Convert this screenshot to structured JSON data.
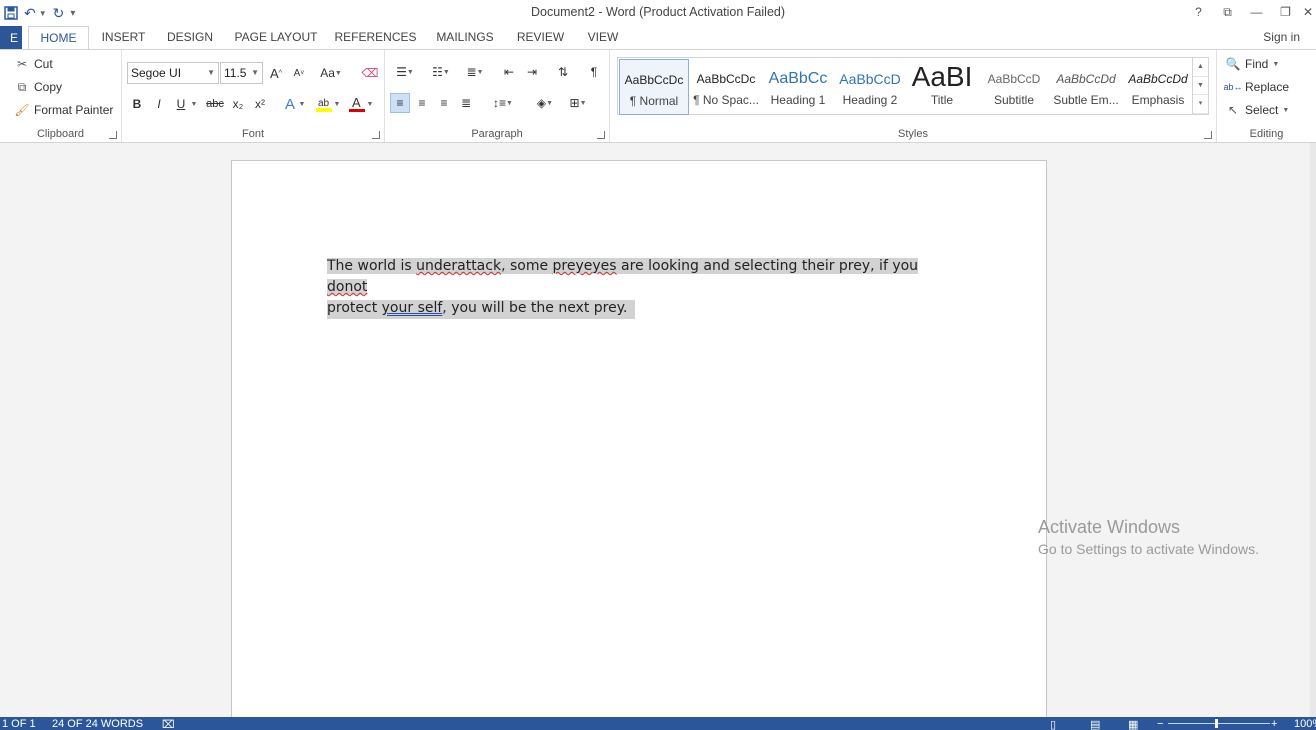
{
  "window": {
    "title": "Document2 - Word (Product Activation Failed)",
    "help": "?",
    "ribbon_display": "⧉",
    "minimize": "—",
    "restore": "❐",
    "close": "✕"
  },
  "qat": {
    "save": "💾",
    "undo": "↶",
    "redo": "↻",
    "customize": "▾"
  },
  "tabs": {
    "file": "E",
    "items": [
      "HOME",
      "INSERT",
      "DESIGN",
      "PAGE LAYOUT",
      "REFERENCES",
      "MAILINGS",
      "REVIEW",
      "VIEW"
    ],
    "active": "HOME",
    "signin": "Sign in"
  },
  "clipboard": {
    "cut": "Cut",
    "copy": "Copy",
    "format_painter": "Format Painter",
    "group_label": "Clipboard"
  },
  "font": {
    "name": "Segoe UI",
    "size": "11.5",
    "grow": "A",
    "shrink": "A",
    "change_case": "Aa",
    "bold": "B",
    "italic": "I",
    "underline": "U",
    "strikethrough": "abc",
    "subscript": "x₂",
    "superscript": "x²",
    "font_color_letter": "A",
    "group_label": "Font"
  },
  "paragraph": {
    "group_label": "Paragraph",
    "pilcrow": "¶"
  },
  "styles": {
    "group_label": "Styles",
    "items": [
      {
        "sample": "AaBbCcDc",
        "name": "¶ Normal"
      },
      {
        "sample": "AaBbCcDc",
        "name": "¶ No Spac..."
      },
      {
        "sample": "AaBbCc",
        "name": "Heading 1"
      },
      {
        "sample": "AaBbCcD",
        "name": "Heading 2"
      },
      {
        "sample": "AaBI",
        "name": "Title"
      },
      {
        "sample": "AaBbCcD",
        "name": "Subtitle"
      },
      {
        "sample": "AaBbCcDd",
        "name": "Subtle Em..."
      },
      {
        "sample": "AaBbCcDd",
        "name": "Emphasis"
      }
    ]
  },
  "editing": {
    "find": "Find",
    "replace": "Replace",
    "select": "Select",
    "group_label": "Editing"
  },
  "document": {
    "line1": {
      "a": "The world is ",
      "b": "underattack",
      "c": ", some ",
      "d": "preyeyes",
      "e": " are looking and selecting their prey, if you ",
      "f": "donot"
    },
    "line2": {
      "a": "protect ",
      "b": "your self",
      "c": ", you will be the next prey."
    }
  },
  "watermark": {
    "line1": "Activate Windows",
    "line2": "Go to Settings to activate Windows."
  },
  "status": {
    "page": "1 OF 1",
    "words": "24 OF 24 WORDS",
    "zoom": "100%"
  }
}
